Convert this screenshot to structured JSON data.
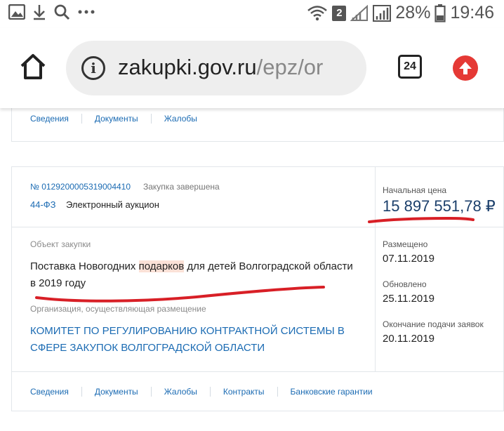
{
  "status_bar": {
    "battery": "28%",
    "time": "19:46",
    "sim": "2"
  },
  "browser": {
    "url_domain": "zakupki.gov.ru",
    "url_path": "/epz/or",
    "tab_count": "24"
  },
  "top_card": {
    "links": [
      "Сведения",
      "Документы",
      "Жалобы"
    ]
  },
  "main_card": {
    "reg_number": "№ 0129200005319004410",
    "status": "Закупка завершена",
    "law": "44-ФЗ",
    "method": "Электронный аукцион",
    "price_label": "Начальная цена",
    "price_value": "15 897 551,78 ₽",
    "object_label": "Объект закупки",
    "object_before": "Поставка Новогодних ",
    "object_highlight": "подарков",
    "object_after": " для детей Волгоградской области в 2019 году",
    "org_label": "Организация, осуществляющая размещение",
    "org_name": "КОМИТЕТ ПО РЕГУЛИРОВАНИЮ КОНТРАКТНОЙ СИСТЕМЫ В СФЕРЕ ЗАКУПОК ВОЛГОГРАДСКОЙ ОБЛАСТИ",
    "placed_label": "Размещено",
    "placed_date": "07.11.2019",
    "updated_label": "Обновлено",
    "updated_date": "25.11.2019",
    "deadline_label": "Окончание подачи заявок",
    "deadline_date": "20.11.2019",
    "links": [
      "Сведения",
      "Документы",
      "Жалобы",
      "Контракты",
      "Банковские гарантии"
    ]
  },
  "colors": {
    "link": "#1b6bb3",
    "annotation": "#d81f26",
    "upload": "#e53935"
  }
}
